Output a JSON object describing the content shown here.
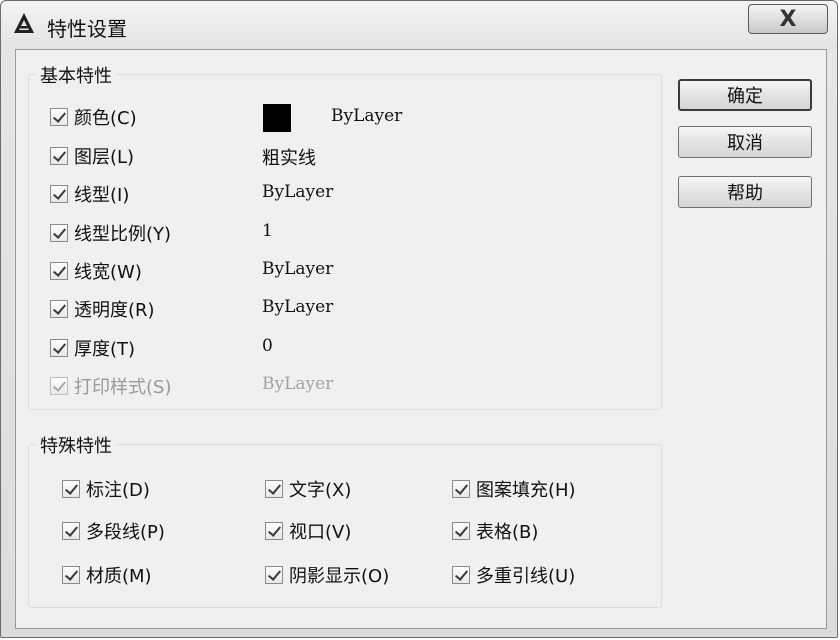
{
  "window": {
    "title": "特性设置",
    "close_glyph": "X"
  },
  "basic": {
    "title": "基本特性",
    "items": [
      {
        "label": "颜色(C)",
        "value": "ByLayer",
        "checked": true,
        "enabled": true
      },
      {
        "label": "图层(L)",
        "value": "粗实线",
        "checked": true,
        "enabled": true
      },
      {
        "label": "线型(I)",
        "value": "ByLayer",
        "checked": true,
        "enabled": true
      },
      {
        "label": "线型比例(Y)",
        "value": "1",
        "checked": true,
        "enabled": true
      },
      {
        "label": "线宽(W)",
        "value": "ByLayer",
        "checked": true,
        "enabled": true
      },
      {
        "label": "透明度(R)",
        "value": "ByLayer",
        "checked": true,
        "enabled": true
      },
      {
        "label": "厚度(T)",
        "value": "0",
        "checked": true,
        "enabled": true
      },
      {
        "label": "打印样式(S)",
        "value": "ByLayer",
        "checked": true,
        "enabled": false
      }
    ],
    "color_swatch": "#000000"
  },
  "special": {
    "title": "特殊特性",
    "items": [
      {
        "label": "标注(D)",
        "checked": true
      },
      {
        "label": "文字(X)",
        "checked": true
      },
      {
        "label": "图案填充(H)",
        "checked": true
      },
      {
        "label": "多段线(P)",
        "checked": true
      },
      {
        "label": "视口(V)",
        "checked": true
      },
      {
        "label": "表格(B)",
        "checked": true
      },
      {
        "label": "材质(M)",
        "checked": true
      },
      {
        "label": "阴影显示(O)",
        "checked": true
      },
      {
        "label": "多重引线(U)",
        "checked": true
      }
    ]
  },
  "buttons": {
    "ok": "确定",
    "cancel": "取消",
    "help": "帮助"
  }
}
